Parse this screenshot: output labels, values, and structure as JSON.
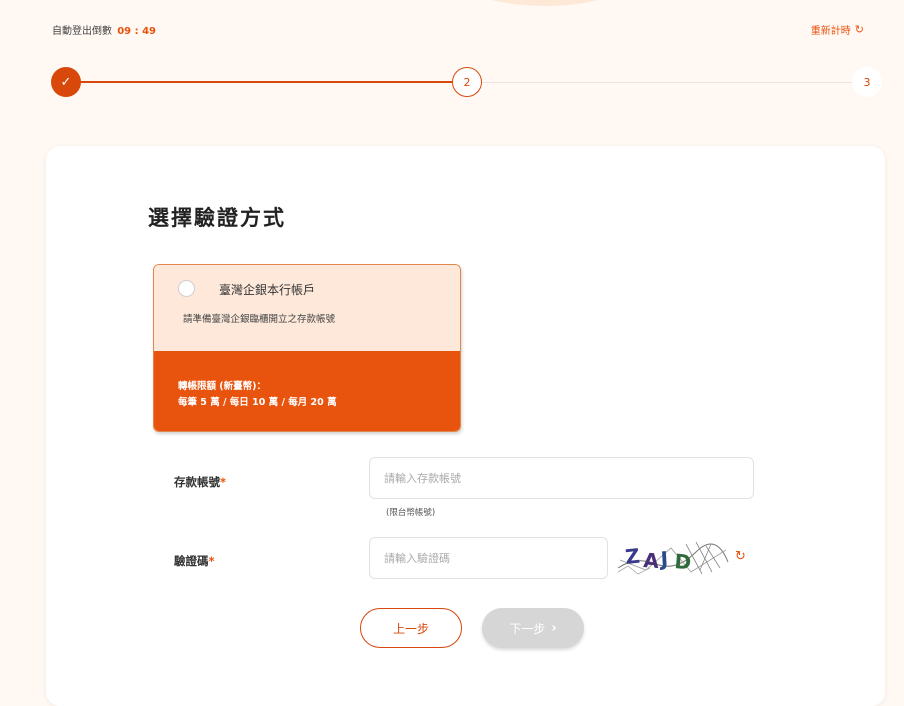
{
  "header": {
    "timer_label": "自動登出倒數",
    "timer_value": "09 : 49",
    "reset_label": "重新計時",
    "reset_icon": "refresh-icon"
  },
  "stepper": {
    "steps": [
      {
        "label": "✓",
        "state": "done"
      },
      {
        "label": "2",
        "state": "current"
      },
      {
        "label": "3",
        "state": "todo"
      }
    ]
  },
  "main": {
    "title": "選擇驗證方式",
    "option": {
      "name": "臺灣企銀本行帳戶",
      "description": "請準備臺灣企銀臨櫃開立之存款帳號",
      "limit_label": "轉帳限額 (新臺幣)：",
      "limit_value": "每筆 5 萬 / 每日 10 萬 / 每月 20 萬"
    },
    "form": {
      "account_label": "存款帳號",
      "required_mark": "*",
      "account_placeholder": "請輸入存款帳號",
      "account_hint": "(限台幣帳號)",
      "captcha_label": "驗證碼",
      "captcha_placeholder": "請輸入驗證碼",
      "captcha_text": "ZAJD"
    },
    "buttons": {
      "prev": "上一步",
      "next": "下一步",
      "next_icon": "chevron-right-icon"
    }
  },
  "colors": {
    "accent": "#e8530d",
    "accent_dark": "#d9480b",
    "card_bg": "#fde8da",
    "page_bg": "#fff8f3"
  }
}
